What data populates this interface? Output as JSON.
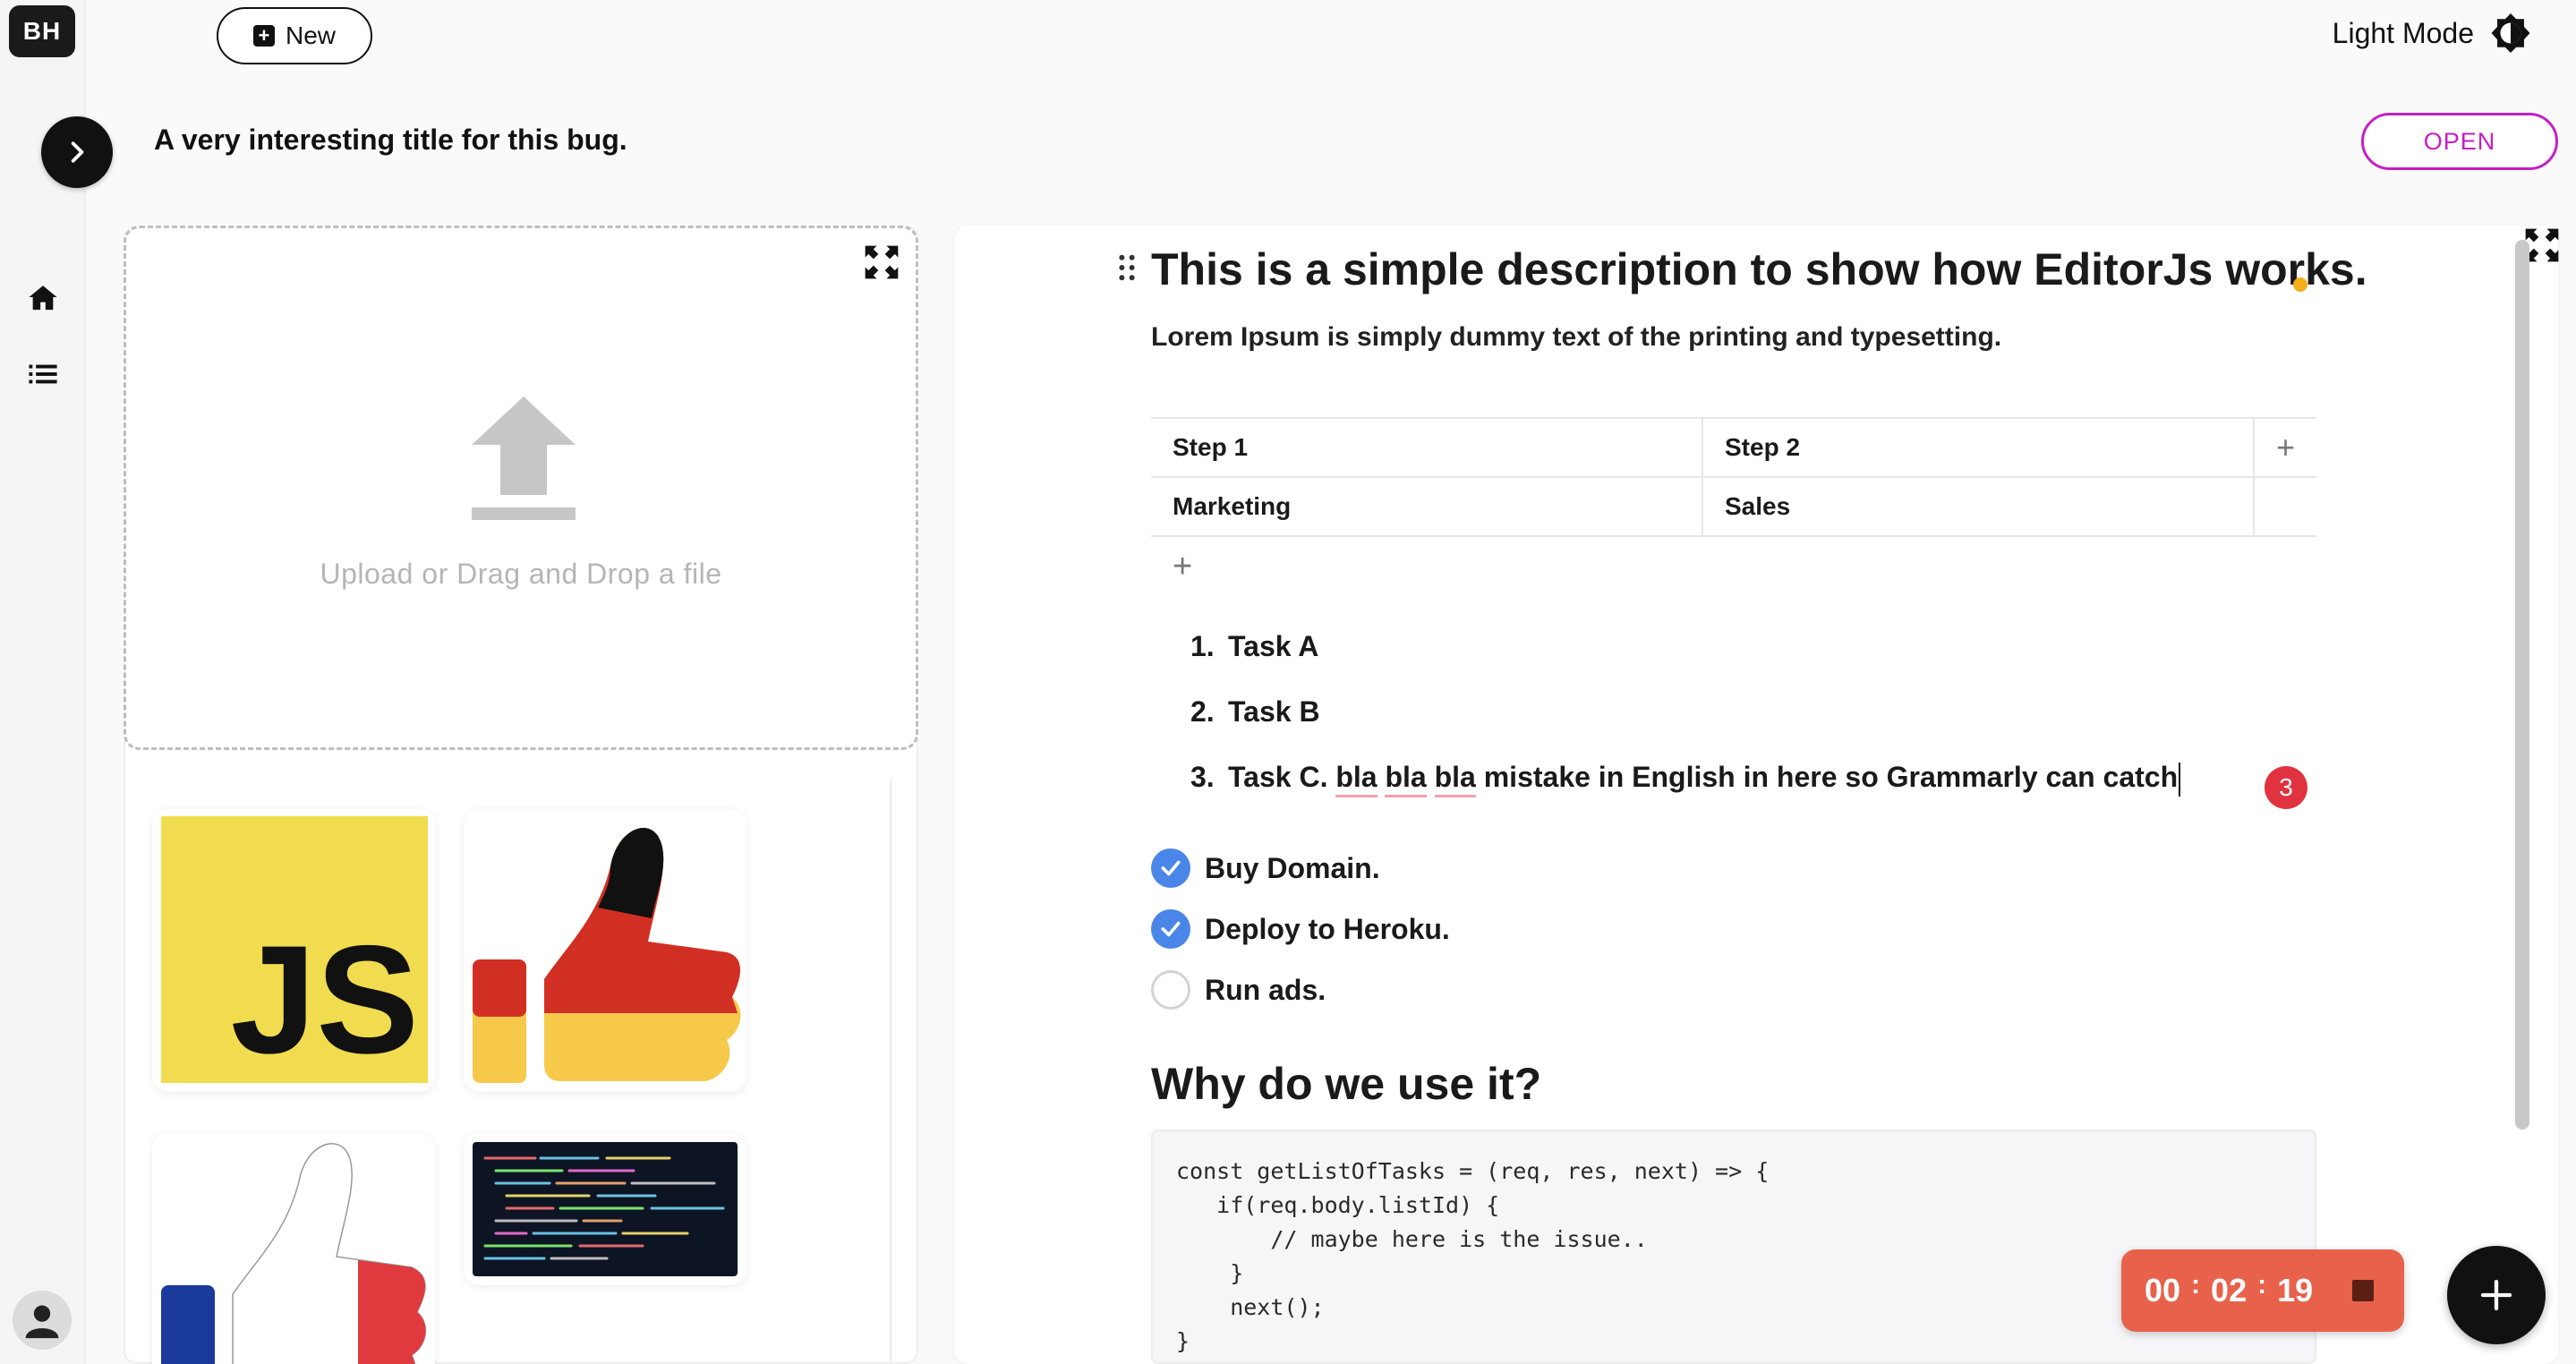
{
  "app": {
    "logo_text": "BH"
  },
  "sidebar": {
    "items": [
      {
        "icon": "home-icon"
      },
      {
        "icon": "list-icon"
      }
    ],
    "avatar_icon": "user-icon"
  },
  "header": {
    "new_label": "New",
    "mode_label": "Light Mode",
    "bug_title": "A very interesting title for this bug.",
    "status_label": "OPEN"
  },
  "upload": {
    "text": "Upload or Drag and Drop a file"
  },
  "gallery": {
    "images": [
      "js-logo-image",
      "german-thumbs-up-image",
      "french-thumbs-up-image",
      "code-screen-image"
    ]
  },
  "editor": {
    "heading": "This is a simple description to show how EditorJs works.",
    "paragraph": "Lorem Ipsum is simply dummy text of the printing and typesetting.",
    "table": {
      "rows": [
        [
          "Step 1",
          "Step 2"
        ],
        [
          "Marketing",
          "Sales"
        ]
      ],
      "add_col": "+",
      "add_row": "+"
    },
    "ordered_list": [
      {
        "num": "1.",
        "text": "Task A"
      },
      {
        "num": "2.",
        "text": "Task B"
      },
      {
        "num": "3.",
        "prefix": "Task C. ",
        "err1": "bla",
        "err2": "bla",
        "err3": "bla",
        "suffix": " mistake in English in here so Grammarly can catch"
      }
    ],
    "grammarly_count": "3",
    "checklist": [
      {
        "text": "Buy Domain.",
        "checked": true
      },
      {
        "text": "Deploy to Heroku.",
        "checked": true
      },
      {
        "text": "Run ads.",
        "checked": false
      }
    ],
    "heading2": "Why do we use it?",
    "code": "const getListOfTasks = (req, res, next) => {\n   if(req.body.listId) {\n       // maybe here is the issue..\n    }\n    next();\n}"
  },
  "timer": {
    "hours": "00",
    "minutes": "02",
    "seconds": "19",
    "separator": ":"
  },
  "colors": {
    "status": "#c51fc5",
    "timer": "#e8614b",
    "check": "#4a86e8",
    "badge": "#e0323f"
  }
}
